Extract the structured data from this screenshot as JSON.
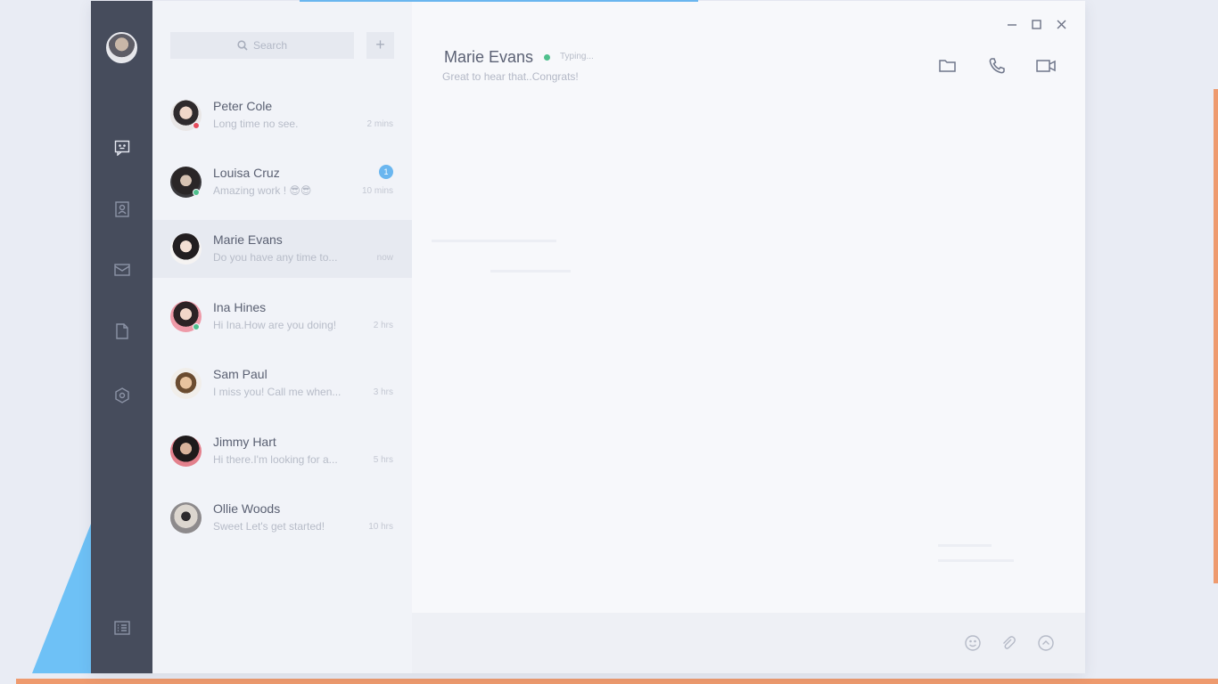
{
  "search": {
    "placeholder": "Search",
    "add_label": "+"
  },
  "rail": {
    "icons": [
      "avatar",
      "chat-icon",
      "contacts-icon",
      "mail-icon",
      "document-icon",
      "settings-icon",
      "list-icon"
    ]
  },
  "conversations": [
    {
      "name": "Peter Cole",
      "message": "Long time no see.",
      "time": "2 mins",
      "status": "busy"
    },
    {
      "name": "Louisa Cruz",
      "message": "Amazing work ! 😎😎",
      "time": "10 mins",
      "status": "online",
      "badge": "1"
    },
    {
      "name": "Marie Evans",
      "message": "Do you have any time to...",
      "time": "now",
      "status": "none"
    },
    {
      "name": "Ina Hines",
      "message": "Hi Ina.How are you doing!",
      "time": "2 hrs",
      "status": "online"
    },
    {
      "name": "Sam Paul",
      "message": "I miss you! Call me when...",
      "time": "3 hrs",
      "status": "none"
    },
    {
      "name": "Jimmy Hart",
      "message": "Hi there.I'm looking for a...",
      "time": "5 hrs",
      "status": "none"
    },
    {
      "name": "Ollie Woods",
      "message": "Sweet Let's get started!",
      "time": "10 hrs",
      "status": "none"
    }
  ],
  "chat": {
    "name": "Marie Evans",
    "typing": "Typing...",
    "subtitle": "Great to hear that..Congrats!"
  },
  "colors": {
    "rail": "#464c5c",
    "accent_blue": "#6ab6ef",
    "online": "#4fc08d",
    "busy": "#e74c5c",
    "stripe": "#ee9a6e"
  }
}
